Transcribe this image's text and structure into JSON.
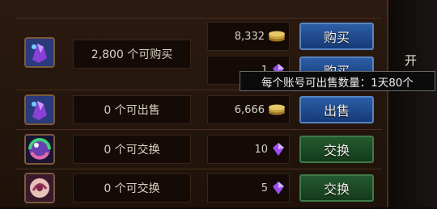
{
  "rows": [
    {
      "item_icon": "purple-crystal-bag-icon",
      "count_text": "2,800 个可购买",
      "prices": [
        {
          "value": "8,332",
          "currency_icon": "gold-coin-icon"
        },
        {
          "value": "1",
          "currency_icon": "purple-crystal-icon"
        }
      ],
      "buttons": [
        "购买",
        "购买"
      ],
      "button_style": "blue"
    },
    {
      "item_icon": "purple-crystal-bag-icon",
      "count_text": "0 个可出售",
      "prices": [
        {
          "value": "6,666",
          "currency_icon": "gold-coin-icon"
        }
      ],
      "buttons": [
        "出售"
      ],
      "button_style": "blue"
    },
    {
      "item_icon": "rainbow-orb-icon",
      "count_text": "0 个可交换",
      "prices": [
        {
          "value": "10",
          "currency_icon": "purple-crystal-icon"
        }
      ],
      "buttons": [
        "交换"
      ],
      "button_style": "green"
    },
    {
      "item_icon": "pink-scroll-icon",
      "count_text": "0 个可交换",
      "prices": [
        {
          "value": "5",
          "currency_icon": "purple-crystal-icon"
        }
      ],
      "buttons": [
        "交换"
      ],
      "button_style": "green"
    }
  ],
  "tooltip": "每个账号可出售数量：1天80个",
  "side_glyph": "开",
  "colors": {
    "button_blue": "#1f4a8c",
    "button_green": "#1d4a25",
    "panel": "#24160d",
    "text": "#d9d1c5"
  }
}
